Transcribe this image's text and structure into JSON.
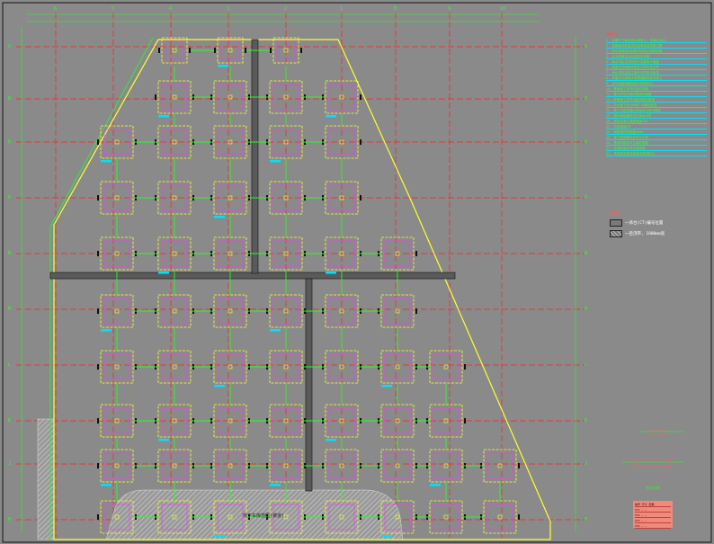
{
  "drawing": {
    "colors": {
      "background": "#8a8a8a",
      "grid_axis": "#ff2020",
      "boundary": "#ffff33",
      "structure": "#22ff22",
      "column_box": "#ffff33",
      "column_inner": "#ff33ff",
      "label": "#00e0ff",
      "wall": "#555555"
    },
    "column_grid_top": [
      "6",
      "5",
      "4",
      "3",
      "2",
      "1",
      "8",
      "9",
      "10"
    ],
    "row_grid_left": [
      "S",
      "R",
      "Q",
      "P",
      "N",
      "M",
      "L",
      "K",
      "J",
      "H"
    ],
    "notes": {
      "title": "说明:",
      "lines": [
        "1. 本图尺寸单位均以毫米计, 标高以米计",
        "2. 柱基础顶标高详见各单体结构施工图",
        "3. 防水板厚度及配筋详见防水板配筋图",
        "4. 后浇带做法详见结构总说明",
        "5. 集水坑定位详见地下室建筑平面图",
        "6. 地梁未注明者均居柱中或与柱边齐",
        "7. 承台顶标高除注明外均同防水板顶",
        "8. 本图应与建筑水电暖通图纸配合施工",
        "9. 未尽事宜按国家现行规范执行",
        "10. 基础施工完毕应及时回填",
        "11. 基坑开挖应做好降排水措施",
        "12. 桩基施工应符合相关规范要求",
        "13. 防水板下设100厚C15素砼垫层",
        "14. 施工中如有疑问请及时与设计联系",
        "15. 图中承台编号详见承台大样",
        "16. 底板混凝土强度等级C35",
        "17. 抗渗等级P8",
        "18. 钢筋保护层厚度50mm",
        "19. 施工缝设置详见节点大样",
        "20. 基础梁配筋详见梁配筋图",
        "21. 坡道处做法详见建筑图",
        "22. 本说明未提及者按总说明执行"
      ]
    },
    "legend": {
      "title": "图例:",
      "items": [
        {
          "label": "一承台(CT)编号位置",
          "style": "solid"
        },
        {
          "label": "一后浇带, 1800mm宽",
          "style": "hatch"
        }
      ]
    },
    "parking_label": "地下车库范围(坡道)",
    "detail_label": "节点大样",
    "table": {
      "rows": [
        "编号 尺寸 配筋",
        "CT1  —  —",
        "CT2  —  —",
        "CT3  —  —",
        "CT4  —  —"
      ]
    }
  }
}
